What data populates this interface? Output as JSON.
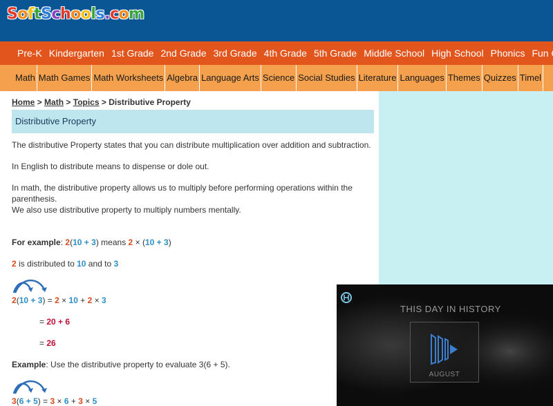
{
  "logo": {
    "letters": [
      {
        "ch": "S",
        "color": "#e23a2c"
      },
      {
        "ch": "o",
        "color": "#f28c1e"
      },
      {
        "ch": "f",
        "color": "#f4c21c"
      },
      {
        "ch": "t",
        "color": "#3aa53c"
      },
      {
        "ch": "S",
        "color": "#2f7ed8"
      },
      {
        "ch": "c",
        "color": "#8a3fc1"
      },
      {
        "ch": "h",
        "color": "#e23a2c"
      },
      {
        "ch": "o",
        "color": "#f28c1e"
      },
      {
        "ch": "o",
        "color": "#f4c21c"
      },
      {
        "ch": "l",
        "color": "#3aa53c"
      },
      {
        "ch": "s",
        "color": "#2f7ed8"
      },
      {
        "ch": ".",
        "color": "#8a3fc1"
      },
      {
        "ch": "c",
        "color": "#e23a2c"
      },
      {
        "ch": "o",
        "color": "#f28c1e"
      },
      {
        "ch": "m",
        "color": "#3aa53c"
      }
    ]
  },
  "nav_primary": [
    "Pre-K",
    "Kindergarten",
    "1st Grade",
    "2nd Grade",
    "3rd Grade",
    "4th Grade",
    "5th Grade",
    "Middle School",
    "High School",
    "Phonics",
    "Fun Gam"
  ],
  "nav_secondary": [
    "Math",
    "Math Games",
    "Math Worksheets",
    "Algebra",
    "Language Arts",
    "Science",
    "Social Studies",
    "Literature",
    "Languages",
    "Themes",
    "Quizzes",
    "Timel"
  ],
  "breadcrumb": {
    "home": "Home",
    "sep": ">",
    "math": "Math",
    "topics": "Topics",
    "current": "Distributive Property"
  },
  "page_title": "Distributive Property",
  "intro": {
    "p1": "The distributive Property states that you can distribute multiplication over addition and subtraction.",
    "p2": "In English to distribute means to dispense or dole out.",
    "p3a": "In math, the distributive property allows us to multiply before performing operations within the parenthesis.",
    "p3b": "We also use distributive property to multiply numbers mentally."
  },
  "example1": {
    "label": "For example",
    "colon": ":",
    "a": "2",
    "lp": "(",
    "b": "10",
    "plus": "+",
    "c": "3",
    "rp": ")",
    "means": "means",
    "times": "×",
    "is_distributed_to": "is distributed to",
    "and_to": "and to",
    "eq": "=",
    "step2": "20 + 6",
    "result": "26"
  },
  "example2": {
    "label": "Example",
    "text": ": Use the distributive property to evaluate 3(6 + 5).",
    "a": "3",
    "b": "6",
    "c": "5",
    "lp": "(",
    "plus": "+",
    "rp": ")",
    "eq": "=",
    "times": "×"
  },
  "video": {
    "title": "THIS DAY IN HISTORY",
    "month": "AUGUST"
  },
  "colors": {
    "header": "#0a5694",
    "nav_primary": "#e2561e",
    "nav_secondary": "#f4a04c",
    "title_bar": "#bde6ee",
    "sidebar": "#c8eff2",
    "orange": "#d84a1b",
    "blue": "#2e8fc6",
    "red": "#c0103a"
  }
}
